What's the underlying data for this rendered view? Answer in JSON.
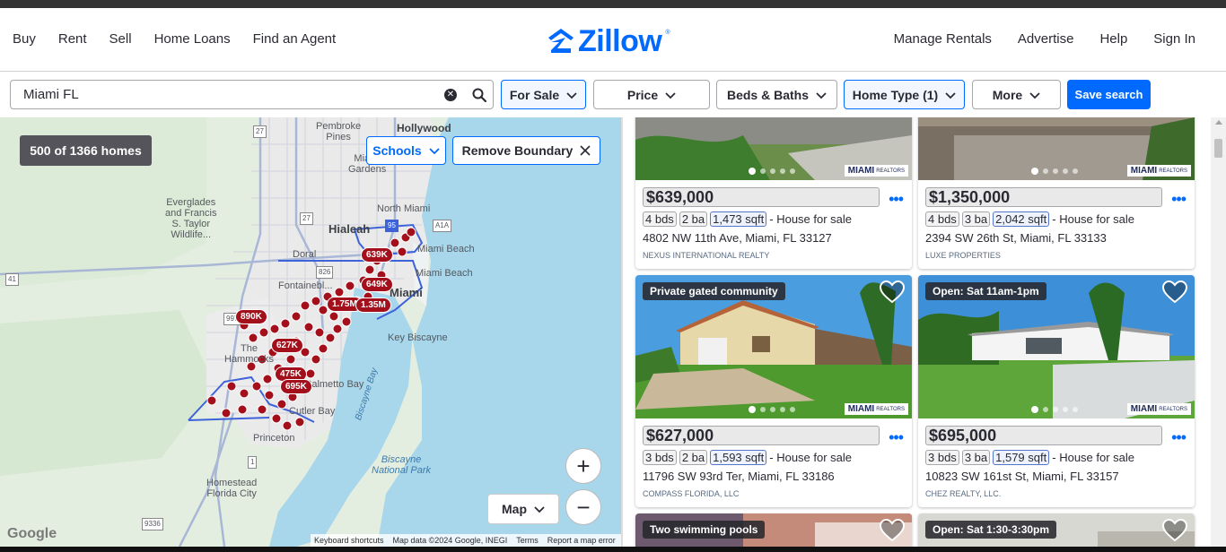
{
  "header": {
    "nav_left": [
      "Buy",
      "Rent",
      "Sell",
      "Home Loans",
      "Find an Agent"
    ],
    "nav_right": [
      "Manage Rentals",
      "Advertise",
      "Help",
      "Sign In"
    ],
    "logo_text": "Zillow",
    "brand_color": "#006aff"
  },
  "search": {
    "value": "Miami FL"
  },
  "filters": {
    "for_sale": "For Sale",
    "price": "Price",
    "beds_baths": "Beds & Baths",
    "home_type": "Home Type (1)",
    "more": "More",
    "save_search": "Save search"
  },
  "map": {
    "count": "500 of 1366 homes",
    "schools": "Schools",
    "remove_boundary": "Remove Boundary",
    "map_type": "Map",
    "zoom_in": "+",
    "zoom_out": "−",
    "google": "Google",
    "attribution": [
      "Keyboard shortcuts",
      "Map data ©2024 Google, INEGI",
      "Terms",
      "Report a map error"
    ],
    "labels": {
      "hollywood": "Hollywood",
      "pembroke_pines": "Pembroke\nPines",
      "miami_gardens": "Miami\nGardens",
      "everglades": "Everglades\nand Francis\nS. Taylor\nWildlife...",
      "north_miami": "North Miami",
      "hialeah": "Hialeah",
      "miami_beach": "Miami Beach",
      "doral": "Doral",
      "fontainebleau": "Fontainebl...",
      "miami": "Miami",
      "key_biscayne": "Key Biscayne",
      "hammocks": "The\nHammocks",
      "cutler_bay": "Cutler Bay",
      "palmetto_bay": "Palmetto Bay",
      "biscayne_bay": "Biscayne Bay",
      "biscayne_np": "Biscayne\nNational Park",
      "princeton": "Princeton",
      "homestead": "Homestead\nFlorida City",
      "r27": "27",
      "r41": "41",
      "r826": "826",
      "r1": "1",
      "r9336": "9336",
      "r95": "95",
      "a1a": "A1A",
      "r997": "997"
    },
    "price_pins": [
      "639K",
      "649K",
      "1.75M",
      "1.35M",
      "890K",
      "627K",
      "475K",
      "695K"
    ]
  },
  "listings": [
    {
      "tag": "",
      "price": "$639,000",
      "beds": "4 bds",
      "baths": "2 ba",
      "sqft": "1,473",
      "sqft_unit": "sqft",
      "type": "- House for sale",
      "address": "4802 NW 11th Ave, Miami, FL 33127",
      "broker": "NEXUS INTERNATIONAL REALTY"
    },
    {
      "tag": "",
      "price": "$1,350,000",
      "beds": "4 bds",
      "baths": "3 ba",
      "sqft": "2,042",
      "sqft_unit": "sqft",
      "type": "- House for sale",
      "address": "2394 SW 26th St, Miami, FL 33133",
      "broker": "LUXE PROPERTIES"
    },
    {
      "tag": "Private gated community",
      "price": "$627,000",
      "beds": "3 bds",
      "baths": "2 ba",
      "sqft": "1,593",
      "sqft_unit": "sqft",
      "type": "- House for sale",
      "address": "11796 SW 93rd Ter, Miami, FL 33186",
      "broker": "COMPASS FLORIDA, LLC"
    },
    {
      "tag": "Open: Sat 11am-1pm",
      "price": "$695,000",
      "beds": "3 bds",
      "baths": "3 ba",
      "sqft": "1,579",
      "sqft_unit": "sqft",
      "type": "- House for sale",
      "address": "10823 SW 161st St, Miami, FL 33157",
      "broker": "CHEZ REALTY, LLC."
    },
    {
      "tag": "Two swimming pools"
    },
    {
      "tag": "Open: Sat 1:30-3:30pm"
    }
  ],
  "mls_logo": {
    "name": "MIAMI",
    "suffix": "REALTORS"
  },
  "icons": [
    "zillow-logo-icon",
    "search-icon",
    "clear-icon",
    "chevron-down-icon",
    "close-icon",
    "heart-icon",
    "more-options-icon"
  ]
}
